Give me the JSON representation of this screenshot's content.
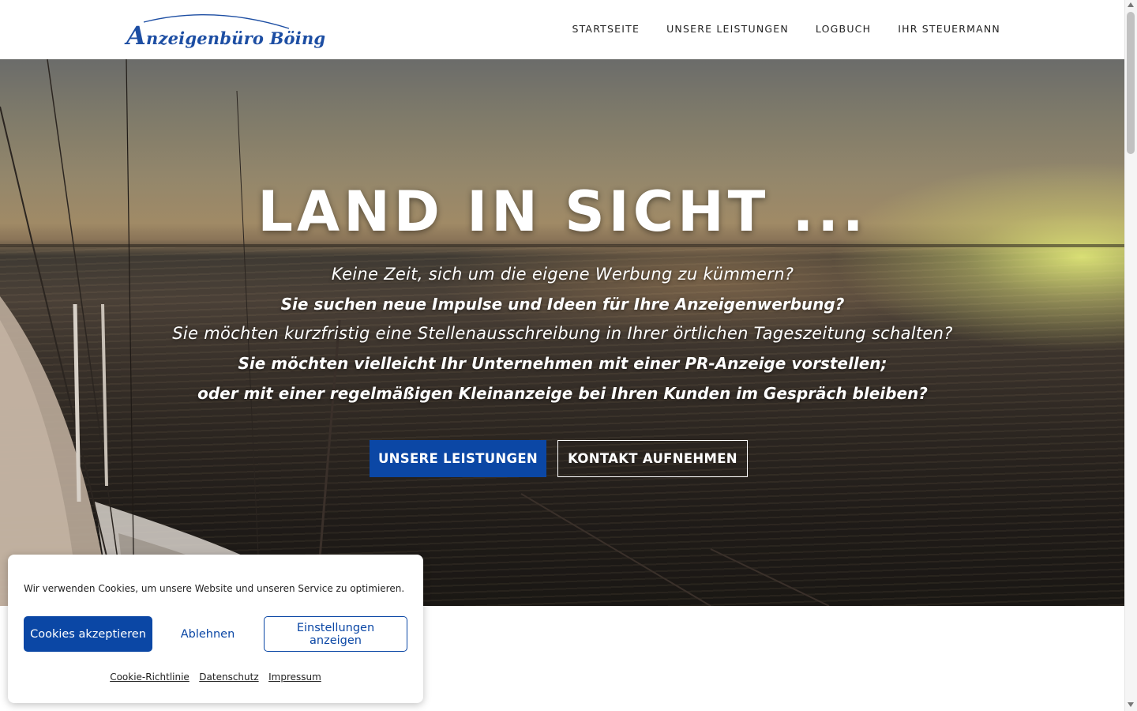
{
  "header": {
    "logo_first_letter": "A",
    "logo_rest": "nzeigenbüro Böing",
    "nav": [
      "STARTSEITE",
      "UNSERE LEISTUNGEN",
      "LOGBUCH",
      "IHR STEUERMANN"
    ]
  },
  "hero": {
    "title": "LAND IN SICHT ...",
    "lines": [
      "Keine Zeit, sich um die eigene Werbung zu kümmern?",
      "Sie suchen neue Impulse und Ideen für Ihre Anzeigenwerbung?",
      "Sie möchten kurzfristig eine Stellenausschreibung in Ihrer örtlichen Tageszeitung schalten?",
      "Sie möchten vielleicht Ihr Unternehmen mit einer PR-Anzeige vorstellen;",
      "oder mit einer regelmäßigen Kleinanzeige bei Ihren Kunden im Gespräch bleiben?"
    ],
    "button_primary": "UNSERE LEISTUNGEN",
    "button_secondary": "KONTAKT AUFNEHMEN"
  },
  "cookie": {
    "text": "Wir verwenden Cookies, um unsere Website und unseren Service zu optimieren.",
    "accept": "Cookies akzeptieren",
    "deny": "Ablehnen",
    "settings": "Einstellungen anzeigen",
    "links": [
      "Cookie-Richtlinie",
      "Datenschutz",
      "Impressum"
    ]
  },
  "colors": {
    "brand_blue": "#0b47a5",
    "logo_blue": "#1d4ea3"
  }
}
